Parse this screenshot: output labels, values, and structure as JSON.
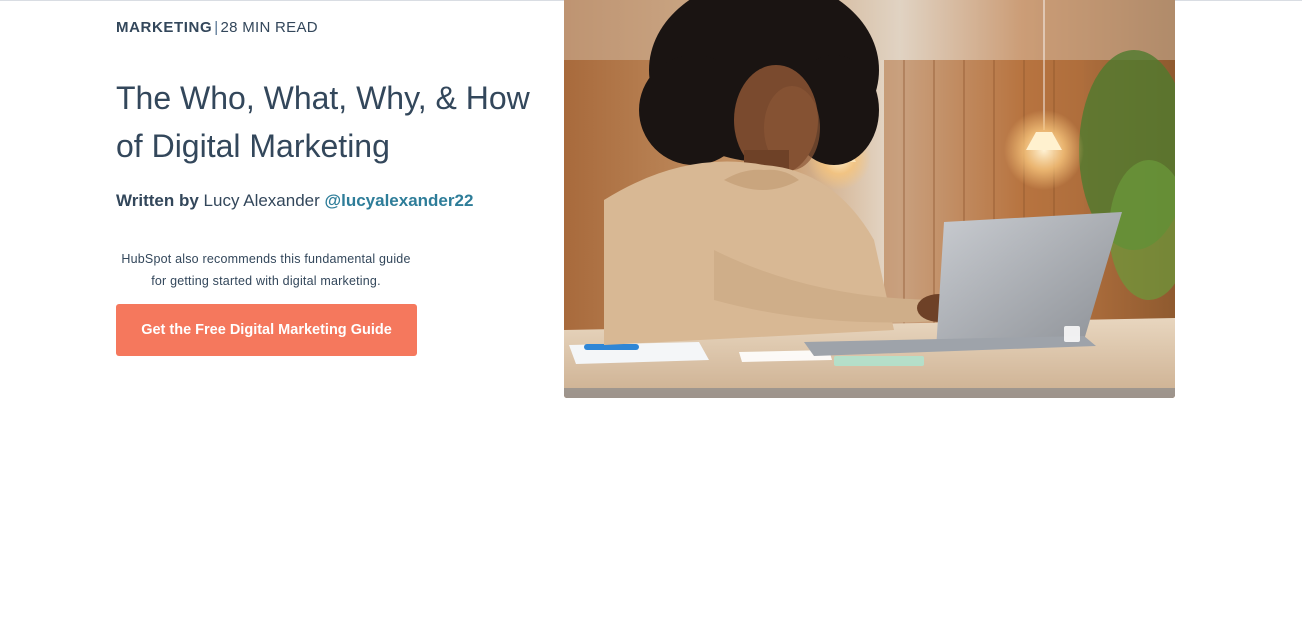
{
  "article": {
    "category": "MARKETING",
    "separator": "|",
    "read_time": "28 MIN READ",
    "title": "The Who, What, Why, & How of Digital Marketing",
    "byline": {
      "prefix": "Written by",
      "author_name": "Lucy Alexander",
      "author_handle": "@lucyalexander22"
    },
    "recommendation_text": "HubSpot also recommends this fundamental guide for getting started with digital marketing.",
    "cta_label": "Get the Free Digital Marketing Guide"
  },
  "hero_image": {
    "subject": "woman typing on laptop in office"
  },
  "colors": {
    "text_primary": "#33475b",
    "link": "#2e7d99",
    "cta_background": "#f5785d",
    "cta_text": "#ffffff"
  }
}
